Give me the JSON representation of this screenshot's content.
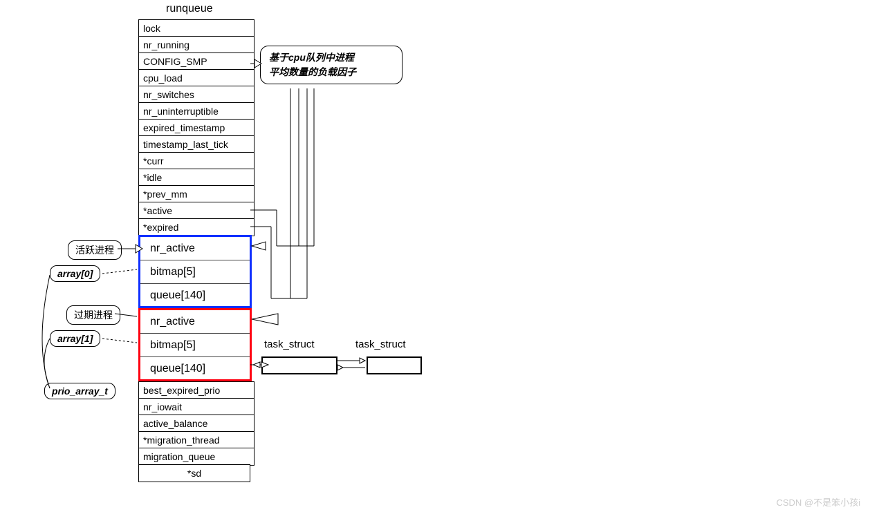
{
  "title": "runqueue",
  "fields_top": [
    "lock",
    "nr_running",
    "CONFIG_SMP",
    "cpu_load",
    "nr_switches",
    "nr_uninterruptible",
    "expired_timestamp",
    "timestamp_last_tick",
    "*curr",
    "*idle",
    "*prev_mm",
    "*active",
    "*expired"
  ],
  "array0": [
    "nr_active",
    "bitmap[5]",
    "queue[140]"
  ],
  "array1": [
    "nr_active",
    "bitmap[5]",
    "queue[140]"
  ],
  "fields_bottom": [
    "best_expired_prio",
    "nr_iowait",
    "active_balance",
    "*migration_thread",
    "migration_queue",
    "*sd"
  ],
  "callout": {
    "line1": "基于cpu队列中进程",
    "line2": "平均数量的负载因子"
  },
  "labels": {
    "active_procs": "活跃进程",
    "expired_procs": "过期进程",
    "array0": "array[0]",
    "array1": "array[1]",
    "prio_array": "prio_array_t",
    "task_struct": "task_struct"
  },
  "watermark": "CSDN @不是笨小孩i"
}
